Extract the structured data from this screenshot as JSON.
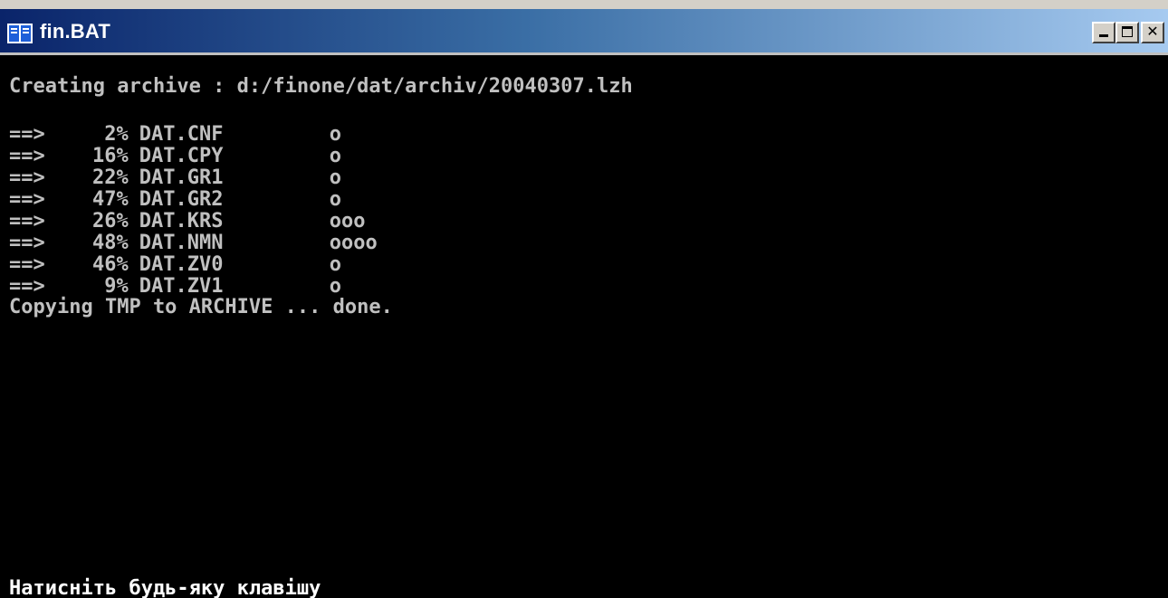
{
  "window": {
    "title": "fin.BAT",
    "controls": {
      "minimize": "_",
      "maximize": "□",
      "close": "✕"
    }
  },
  "console": {
    "header": "Creating archive : d:/finone/dat/archiv/20040307.lzh",
    "entries": [
      {
        "arrow": "==>",
        "percent": "2%",
        "file": "DAT.CNF",
        "progress": "o"
      },
      {
        "arrow": "==>",
        "percent": "16%",
        "file": "DAT.CPY",
        "progress": "o"
      },
      {
        "arrow": "==>",
        "percent": "22%",
        "file": "DAT.GR1",
        "progress": "o"
      },
      {
        "arrow": "==>",
        "percent": "47%",
        "file": "DAT.GR2",
        "progress": "o"
      },
      {
        "arrow": "==>",
        "percent": "26%",
        "file": "DAT.KRS",
        "progress": "ooo"
      },
      {
        "arrow": "==>",
        "percent": "48%",
        "file": "DAT.NMN",
        "progress": "oooo"
      },
      {
        "arrow": "==>",
        "percent": "46%",
        "file": "DAT.ZV0",
        "progress": "o"
      },
      {
        "arrow": "==>",
        "percent": "9%",
        "file": "DAT.ZV1",
        "progress": "o"
      }
    ],
    "status": "Copying TMP to ARCHIVE ... done.",
    "prompt": "Натисніть будь-яку клавішу"
  },
  "colors": {
    "background": "#000000",
    "text": "#c0c0c0",
    "titlebar": "#0a246a"
  },
  "icons": {
    "app": "console-app-icon"
  }
}
